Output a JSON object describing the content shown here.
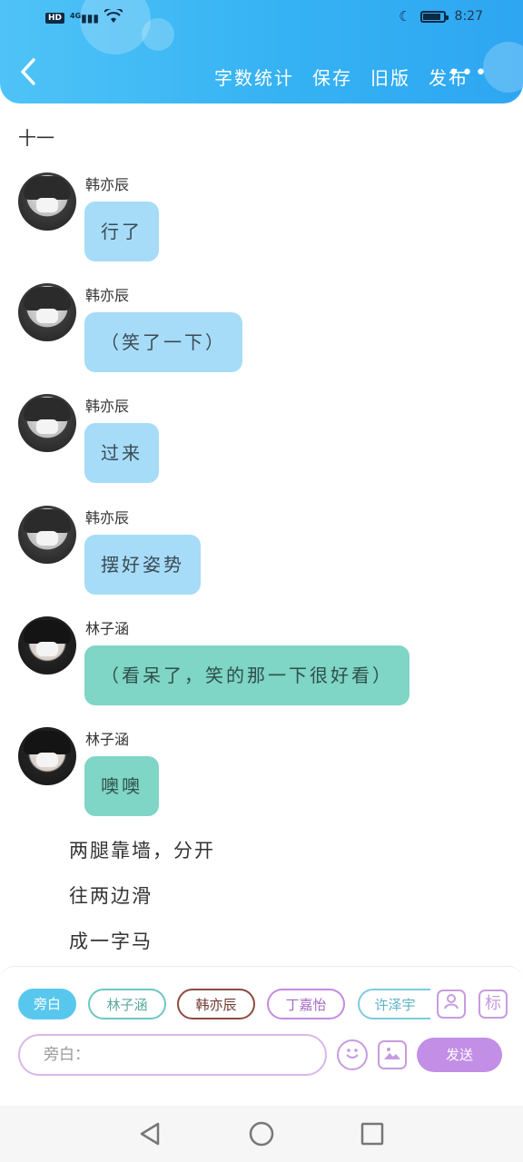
{
  "status_bar": {
    "hd": "HD",
    "network": "4G",
    "time": "8:27",
    "battery_level": 0.85
  },
  "header": {
    "back_icon": "chevron-left-icon",
    "actions": [
      "字数统计",
      "保存",
      "旧版",
      "发布"
    ],
    "more_icon": "more-dots-icon",
    "colors": {
      "gradient_start": "#4fc3f7",
      "gradient_end": "#2ea6f2"
    }
  },
  "chapter_title": "十一",
  "messages": [
    {
      "speaker": "韩亦辰",
      "text": "行了",
      "style": "blue"
    },
    {
      "speaker": "韩亦辰",
      "text": "（笑了一下）",
      "style": "blue"
    },
    {
      "speaker": "韩亦辰",
      "text": "过来",
      "style": "blue"
    },
    {
      "speaker": "韩亦辰",
      "text": "摆好姿势",
      "style": "blue"
    },
    {
      "speaker": "林子涵",
      "text": "（看呆了，笑的那一下很好看）",
      "style": "teal"
    },
    {
      "speaker": "林子涵",
      "text": "噢噢",
      "style": "teal"
    }
  ],
  "narration": [
    "两腿靠墙，分开",
    "往两边滑",
    "成一字马"
  ],
  "composer": {
    "roles": [
      "旁白",
      "林子涵",
      "韩亦辰",
      "丁嘉怡",
      "许泽宇"
    ],
    "active_role": "旁白",
    "role_icon": "person-card-icon",
    "tag_label": "标",
    "input_placeholder": "旁白：",
    "emoji_icon": "smiley-icon",
    "image_icon": "image-icon",
    "send_label": "发送",
    "colors": {
      "send": "#c28ee6",
      "active_chip": "#58c7ee"
    }
  },
  "system_nav": {
    "back_icon": "triangle-back-icon",
    "home_icon": "circle-home-icon",
    "recents_icon": "square-recents-icon"
  }
}
